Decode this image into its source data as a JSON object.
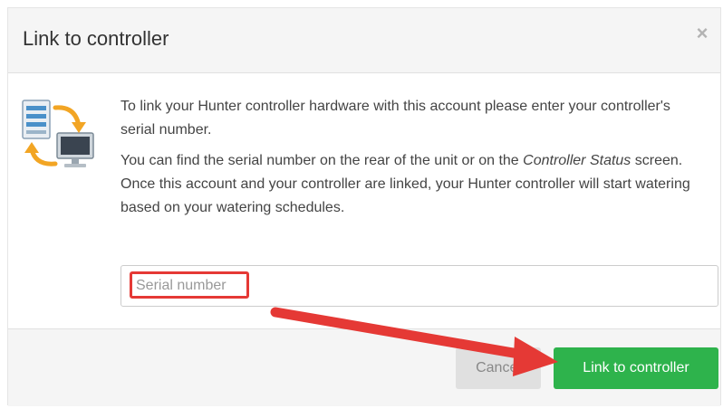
{
  "dialog": {
    "title": "Link to controller",
    "close_symbol": "×"
  },
  "body": {
    "icon": "link-controller-icon",
    "paragraph1": "To link your Hunter controller hardware with this account please enter your controller's serial number.",
    "paragraph2_before": "You can find the serial number on the rear of the unit or on the ",
    "paragraph2_italic": "Controller Status",
    "paragraph2_after": " screen.",
    "paragraph3": "Once this account and your controller are linked, your Hunter controller will start watering based on your watering schedules."
  },
  "serial_input": {
    "placeholder": "Serial number",
    "value": ""
  },
  "footer": {
    "cancel_label": "Cancel",
    "link_label": "Link to controller"
  },
  "colors": {
    "primary_green": "#2eb34c",
    "annotation_red": "#e53935",
    "header_bg": "#f5f5f5"
  }
}
